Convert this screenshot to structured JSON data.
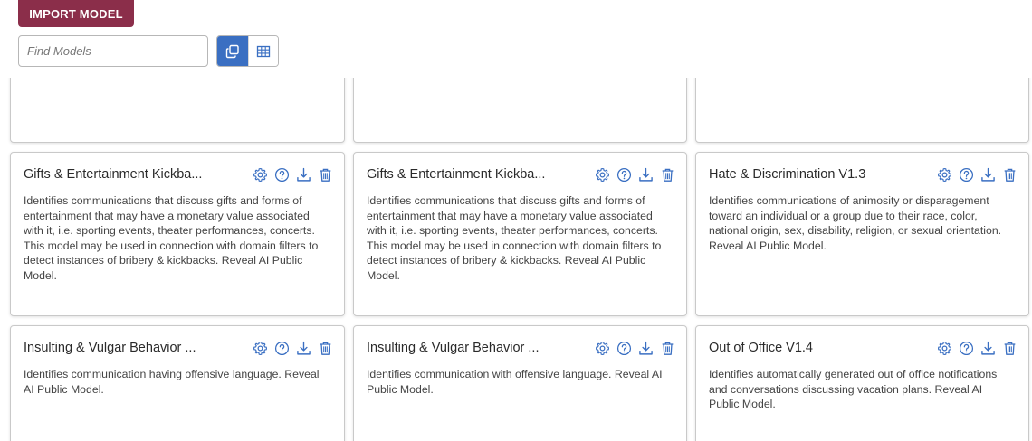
{
  "toolbar": {
    "import_label": "IMPORT MODEL",
    "search_placeholder": "Find Models",
    "views": [
      {
        "icon": "copy-cards-icon",
        "active": true
      },
      {
        "icon": "table-grid-icon",
        "active": false
      }
    ]
  },
  "colors": {
    "brand": "#8b2e4a",
    "accent": "#3a6fc2",
    "icon": "#3a6fc2"
  },
  "cards": [
    {
      "title": "",
      "description": ""
    },
    {
      "title": "",
      "description": ""
    },
    {
      "title": "",
      "description": ""
    },
    {
      "title": "Gifts & Entertainment Kickba...",
      "description": "Identifies communications that discuss gifts and forms of entertainment that may have a monetary value associated with it, i.e. sporting events, theater performances, concerts. This model may be used in connection with domain filters to detect instances of bribery & kickbacks. Reveal AI Public Model."
    },
    {
      "title": "Gifts & Entertainment Kickba...",
      "description": "Identifies communications that discuss gifts and forms of entertainment that may have a monetary value associated with it, i.e. sporting events, theater performances, concerts. This model may be used in connection with domain filters to detect instances of bribery & kickbacks. Reveal AI Public Model."
    },
    {
      "title": "Hate & Discrimination V1.3",
      "description": "Identifies communications of animosity or disparagement toward an individual or a group due to their race, color, national origin, sex, disability, religion, or sexual orientation. Reveal AI Public Model."
    },
    {
      "title": "Insulting & Vulgar Behavior ...",
      "description": "Identifies communication having offensive language. Reveal AI Public Model."
    },
    {
      "title": "Insulting & Vulgar Behavior ...",
      "description": "Identifies communication with offensive language. Reveal AI Public Model."
    },
    {
      "title": "Out of Office V1.4",
      "description": "Identifies automatically generated out of office notifications and conversations discussing vacation plans. Reveal AI Public Model."
    }
  ]
}
